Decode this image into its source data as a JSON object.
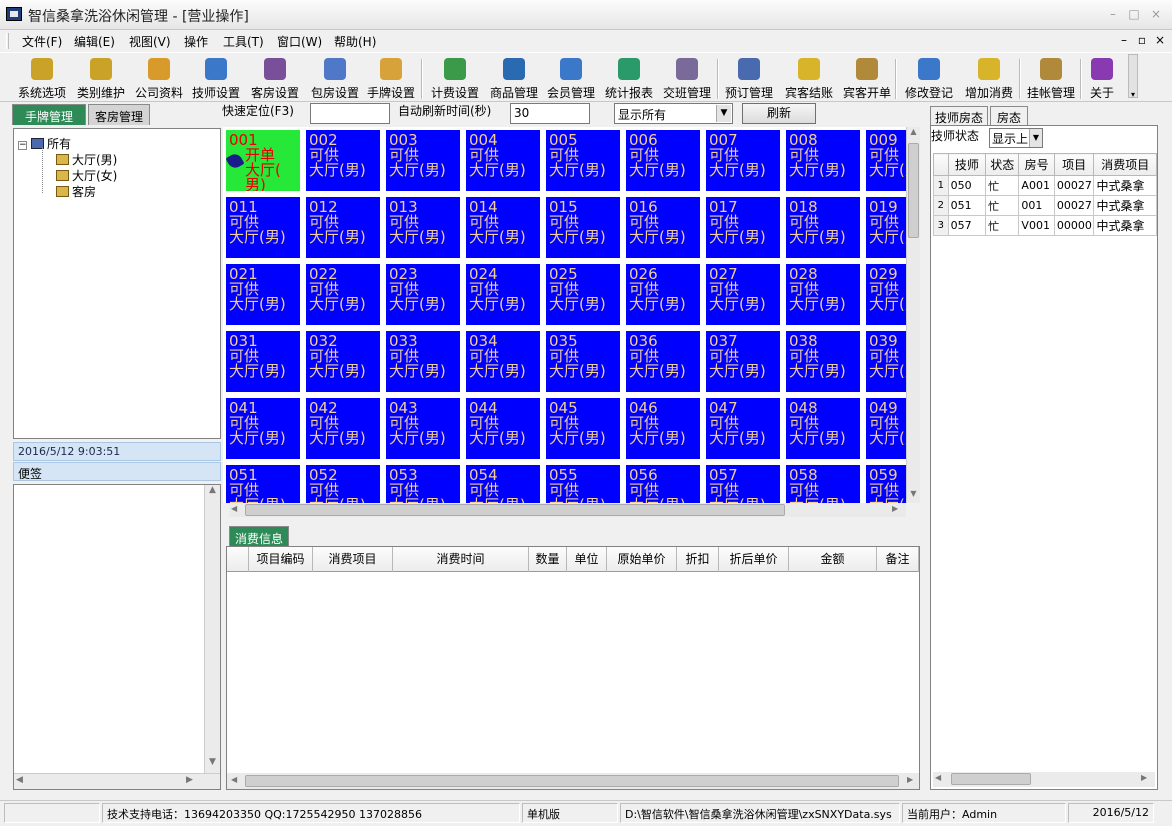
{
  "window": {
    "title": "智信桑拿洗浴休闲管理 - [营业操作]",
    "controls": [
      "–",
      "□",
      "×"
    ]
  },
  "menu": [
    "文件(F)",
    "编辑(E)",
    "视图(V)",
    "操作",
    "工具(T)",
    "窗口(W)",
    "帮助(H)"
  ],
  "mdi_controls": [
    "–",
    "▫",
    "×"
  ],
  "toolbar": [
    {
      "label": "系统选项",
      "icon": "key-icon"
    },
    {
      "label": "类别维护",
      "icon": "key-icon"
    },
    {
      "label": "公司资料",
      "icon": "folder-icon"
    },
    {
      "label": "技师设置",
      "icon": "person-icon"
    },
    {
      "label": "客房设置",
      "icon": "building-icon"
    },
    {
      "label": "包房设置",
      "icon": "building-icon"
    },
    {
      "label": "手牌设置",
      "icon": "hand-card-icon"
    },
    {
      "label": "计费设置",
      "icon": "money-icon"
    },
    {
      "label": "商品管理",
      "icon": "box-icon"
    },
    {
      "label": "会员管理",
      "icon": "member-icon"
    },
    {
      "label": "统计报表",
      "icon": "chart-icon"
    },
    {
      "label": "交班管理",
      "icon": "people-icon"
    },
    {
      "label": "预订管理",
      "icon": "stapler-icon"
    },
    {
      "label": "宾客结账",
      "icon": "coin-icon"
    },
    {
      "label": "宾客开单",
      "icon": "package-icon"
    },
    {
      "label": "修改登记",
      "icon": "edit-user-icon"
    },
    {
      "label": "增加消费",
      "icon": "add-icon"
    },
    {
      "label": "挂帐管理",
      "icon": "moneybag-icon"
    },
    {
      "label": "关于",
      "icon": "help-icon"
    }
  ],
  "left_tabs": [
    "手牌管理",
    "客房管理"
  ],
  "tree": {
    "root": "所有",
    "children": [
      "大厅(男)",
      "大厅(女)",
      "客房"
    ]
  },
  "datetime": "2016/5/12  9:03:51",
  "memo_label": "便签",
  "quick": {
    "locate_label": "快速定位(F3)",
    "locate_value": "",
    "auto_refresh_label": "自动刷新时间(秒)",
    "auto_refresh_value": "30",
    "filter_value": "显示所有",
    "refresh_label": "刷新"
  },
  "rooms": [
    {
      "no": "001",
      "status": "开单",
      "area": "大厅(",
      "area2": "男)",
      "busy": true
    },
    {
      "no": "002",
      "status": "可供",
      "area": "大厅(男)",
      "busy": false
    },
    {
      "no": "003",
      "status": "可供",
      "area": "大厅(男)",
      "busy": false
    },
    {
      "no": "004",
      "status": "可供",
      "area": "大厅(男)",
      "busy": false
    },
    {
      "no": "005",
      "status": "可供",
      "area": "大厅(男)",
      "busy": false
    },
    {
      "no": "006",
      "status": "可供",
      "area": "大厅(男)",
      "busy": false
    },
    {
      "no": "007",
      "status": "可供",
      "area": "大厅(男)",
      "busy": false
    },
    {
      "no": "008",
      "status": "可供",
      "area": "大厅(男)",
      "busy": false
    },
    {
      "no": "009",
      "status": "可供",
      "area": "大厅(男)",
      "busy": false
    },
    {
      "no": "011",
      "status": "可供",
      "area": "大厅(男)",
      "busy": false
    },
    {
      "no": "012",
      "status": "可供",
      "area": "大厅(男)",
      "busy": false
    },
    {
      "no": "013",
      "status": "可供",
      "area": "大厅(男)",
      "busy": false
    },
    {
      "no": "014",
      "status": "可供",
      "area": "大厅(男)",
      "busy": false
    },
    {
      "no": "015",
      "status": "可供",
      "area": "大厅(男)",
      "busy": false
    },
    {
      "no": "016",
      "status": "可供",
      "area": "大厅(男)",
      "busy": false
    },
    {
      "no": "017",
      "status": "可供",
      "area": "大厅(男)",
      "busy": false
    },
    {
      "no": "018",
      "status": "可供",
      "area": "大厅(男)",
      "busy": false
    },
    {
      "no": "019",
      "status": "可供",
      "area": "大厅(男)",
      "busy": false
    },
    {
      "no": "021",
      "status": "可供",
      "area": "大厅(男)",
      "busy": false
    },
    {
      "no": "022",
      "status": "可供",
      "area": "大厅(男)",
      "busy": false
    },
    {
      "no": "023",
      "status": "可供",
      "area": "大厅(男)",
      "busy": false
    },
    {
      "no": "024",
      "status": "可供",
      "area": "大厅(男)",
      "busy": false
    },
    {
      "no": "025",
      "status": "可供",
      "area": "大厅(男)",
      "busy": false
    },
    {
      "no": "026",
      "status": "可供",
      "area": "大厅(男)",
      "busy": false
    },
    {
      "no": "027",
      "status": "可供",
      "area": "大厅(男)",
      "busy": false
    },
    {
      "no": "028",
      "status": "可供",
      "area": "大厅(男)",
      "busy": false
    },
    {
      "no": "029",
      "status": "可供",
      "area": "大厅(男)",
      "busy": false
    },
    {
      "no": "031",
      "status": "可供",
      "area": "大厅(男)",
      "busy": false
    },
    {
      "no": "032",
      "status": "可供",
      "area": "大厅(男)",
      "busy": false
    },
    {
      "no": "033",
      "status": "可供",
      "area": "大厅(男)",
      "busy": false
    },
    {
      "no": "034",
      "status": "可供",
      "area": "大厅(男)",
      "busy": false
    },
    {
      "no": "035",
      "status": "可供",
      "area": "大厅(男)",
      "busy": false
    },
    {
      "no": "036",
      "status": "可供",
      "area": "大厅(男)",
      "busy": false
    },
    {
      "no": "037",
      "status": "可供",
      "area": "大厅(男)",
      "busy": false
    },
    {
      "no": "038",
      "status": "可供",
      "area": "大厅(男)",
      "busy": false
    },
    {
      "no": "039",
      "status": "可供",
      "area": "大厅(男)",
      "busy": false
    },
    {
      "no": "041",
      "status": "可供",
      "area": "大厅(男)",
      "busy": false
    },
    {
      "no": "042",
      "status": "可供",
      "area": "大厅(男)",
      "busy": false
    },
    {
      "no": "043",
      "status": "可供",
      "area": "大厅(男)",
      "busy": false
    },
    {
      "no": "044",
      "status": "可供",
      "area": "大厅(男)",
      "busy": false
    },
    {
      "no": "045",
      "status": "可供",
      "area": "大厅(男)",
      "busy": false
    },
    {
      "no": "046",
      "status": "可供",
      "area": "大厅(男)",
      "busy": false
    },
    {
      "no": "047",
      "status": "可供",
      "area": "大厅(男)",
      "busy": false
    },
    {
      "no": "048",
      "status": "可供",
      "area": "大厅(男)",
      "busy": false
    },
    {
      "no": "049",
      "status": "可供",
      "area": "大厅(男)",
      "busy": false
    },
    {
      "no": "051",
      "status": "可供",
      "area": "大厅(男)",
      "busy": false
    },
    {
      "no": "052",
      "status": "可供",
      "area": "大厅(男)",
      "busy": false
    },
    {
      "no": "053",
      "status": "可供",
      "area": "大厅(男)",
      "busy": false
    },
    {
      "no": "054",
      "status": "可供",
      "area": "大厅(男)",
      "busy": false
    },
    {
      "no": "055",
      "status": "可供",
      "area": "大厅(男)",
      "busy": false
    },
    {
      "no": "056",
      "status": "可供",
      "area": "大厅(男)",
      "busy": false
    },
    {
      "no": "057",
      "status": "可供",
      "area": "大厅(男)",
      "busy": false
    },
    {
      "no": "058",
      "status": "可供",
      "area": "大厅(男)",
      "busy": false
    },
    {
      "no": "059",
      "status": "可供",
      "area": "大厅(男)",
      "busy": false
    }
  ],
  "consumption": {
    "tab": "消费信息",
    "columns": [
      "项目编码",
      "消费项目",
      "消费时间",
      "数量",
      "单位",
      "原始单价",
      "折扣",
      "折后单价",
      "金额",
      "备注"
    ],
    "rows": []
  },
  "right_tabs": [
    "技师房态",
    "房态"
  ],
  "tech_status_label": "技师状态",
  "tech_status_value": "显示上",
  "tech_table": {
    "columns": [
      "技师",
      "状态",
      "房号",
      "项目",
      "消费项目"
    ],
    "rows": [
      {
        "n": "1",
        "tech": "050",
        "state": "忙",
        "room": "A001",
        "proj": "00027",
        "item": "中式桑拿"
      },
      {
        "n": "2",
        "tech": "051",
        "state": "忙",
        "room": "001",
        "proj": "00027",
        "item": "中式桑拿"
      },
      {
        "n": "3",
        "tech": "057",
        "state": "忙",
        "room": "V001",
        "proj": "00000",
        "item": "中式桑拿"
      }
    ]
  },
  "status": {
    "support": "技术支持电话：13694203350 QQ:1725542950 137028856",
    "edition": "单机版",
    "path": "D:\\智信软件\\智信桑拿洗浴休闲管理\\zxSNXYData.sys",
    "user": "当前用户：Admin",
    "date": "2016/5/12"
  },
  "colors": {
    "room_free": "#0000ff",
    "room_free_text": "#f1cd9a",
    "room_busy": "#25e838",
    "room_busy_text": "#e60000",
    "active_tab": "#2e8b57"
  }
}
